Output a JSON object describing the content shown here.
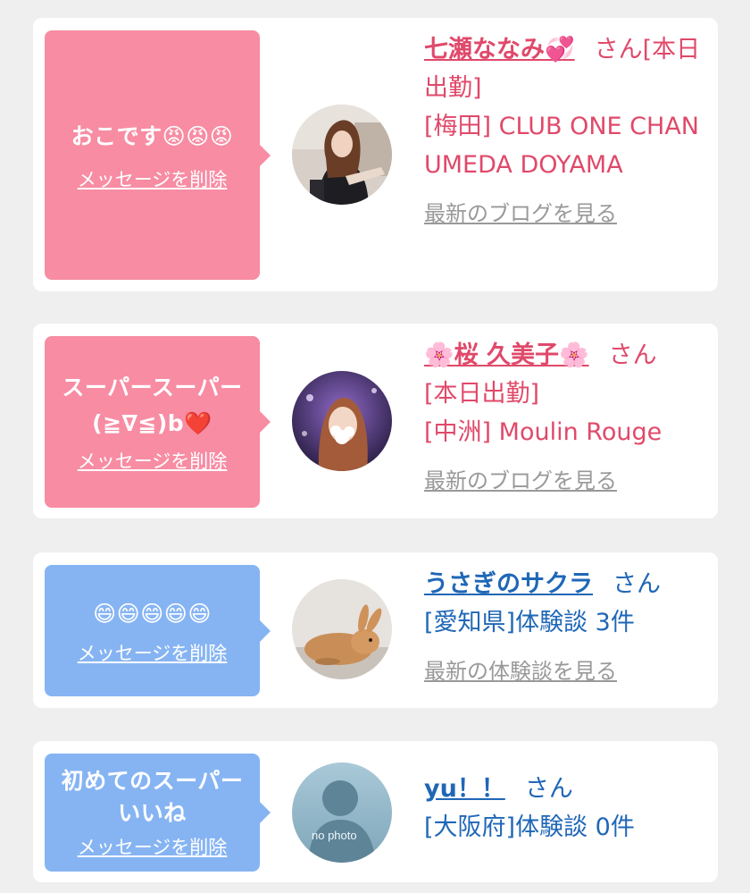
{
  "cards": [
    {
      "message": "おこです😡😡😡",
      "delete_label": "メッセージを削除",
      "name": "七瀬ななみ💞",
      "honorific": "さん",
      "status": "[本日出勤]",
      "shop": "[梅田] CLUB ONE CHAN UMEDA DOYAMA",
      "link": "最新のブログを見る"
    },
    {
      "message": "スーパースーパー (≧∇≦)b❤️",
      "delete_label": "メッセージを削除",
      "name": "🌸桜 久美子🌸",
      "honorific": "さん",
      "status": "[本日出勤]",
      "shop": "[中洲] Moulin Rouge",
      "link": "最新のブログを見る"
    },
    {
      "message": "😄😄😄😄😄",
      "delete_label": "メッセージを削除",
      "name": "うさぎのサクラ",
      "honorific": "さん",
      "detail": "[愛知県]体験談 3件",
      "link": "最新の体験談を見る"
    },
    {
      "message": "初めてのスーパーいいね",
      "delete_label": "メッセージを削除",
      "name": "yu！！",
      "honorific": "さん",
      "detail": "[大阪府]体験談 0件",
      "avatar_text": "no photo"
    }
  ],
  "colors": {
    "pink_bubble": "#f78ca3",
    "blue_bubble": "#86b4f3",
    "pink_text": "#e0496a",
    "blue_text": "#1f67b7"
  }
}
